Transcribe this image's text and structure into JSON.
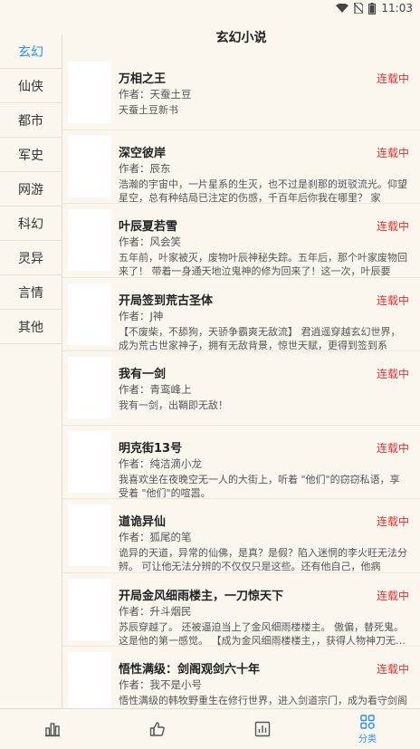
{
  "status_bar": {
    "time": "11:03"
  },
  "header": {
    "title": "玄幻小说"
  },
  "sidebar": {
    "items": [
      {
        "label": "玄幻",
        "active": true
      },
      {
        "label": "仙侠",
        "active": false
      },
      {
        "label": "都市",
        "active": false
      },
      {
        "label": "军史",
        "active": false
      },
      {
        "label": "网游",
        "active": false
      },
      {
        "label": "科幻",
        "active": false
      },
      {
        "label": "灵异",
        "active": false
      },
      {
        "label": "言情",
        "active": false
      },
      {
        "label": "其他",
        "active": false
      }
    ]
  },
  "books": [
    {
      "title": "万相之王",
      "author": "作者：天蚕土豆",
      "desc": "天蚕土豆新书",
      "status": "连载中"
    },
    {
      "title": "深空彼岸",
      "author": "作者：辰东",
      "desc": "浩瀚的宇宙中，一片星系的生灭，也不过是刹那的斑驳流光。仰望星空，总有种结局已注定的伤感，千百年后你我在哪里？ 家国，…",
      "status": "连载中"
    },
    {
      "title": "叶辰夏若雪",
      "author": "作者：风会笑",
      "desc": "五年前，叶家被灭，废物叶辰神秘失踪。五年后，那个叶家废物回来了！ 带着一身通天地泣鬼神的修为回来了！这一次，叶辰要让…",
      "status": "连载中"
    },
    {
      "title": "开局签到荒古圣体",
      "author": "作者：J神",
      "desc": "【不废柴，不舔狗，天骄争霸爽无敌流】 君逍遥穿越玄幻世界，成为荒古世家神子，拥有无敌背景，惊世天赋，更得到签到系统，…",
      "status": "连载中"
    },
    {
      "title": "我有一剑",
      "author": "作者：青鸾峰上",
      "desc": "我有一剑，出鞘即无敌！",
      "status": "连载中"
    },
    {
      "title": "明克街13号",
      "author": "作者：纯洁滴小龙",
      "desc": "我喜欢坐在夜晚空无一人的大街上，听着 \"他们\"的窃窃私语，享受着 \"他们\"的喧嚣。",
      "status": "连载中"
    },
    {
      "title": "道诡异仙",
      "author": "作者：狐尾的笔",
      "desc": "诡异的天道，异常的仙佛，是真？是假？陷入迷惘的李火旺无法分辨。 可让他无法分辨的不仅仅只是这些。还有他自己，他病了，…",
      "status": "连载中"
    },
    {
      "title": "开局金风细雨楼主，一刀惊天下",
      "author": "作者：升斗烟民",
      "desc": "苏辰穿越了。 还被逼迫当上了金风细雨楼楼主。 傲偏，替死鬼。这是他的第一感觉。 【成为金风细雨楼楼主，，获得人物神刀无…",
      "status": "连载中"
    },
    {
      "title": "悟性满级：剑阁观剑六十年",
      "author": "作者：我不是小号",
      "desc": "悟性满级的韩牧野重生在修行世界，进入剑道宗门，成为看守剑阁的观剑人。 剑阁中藏剑十万，观剑人需要每月擦拭长剑一遍。 擦…",
      "status": "连载中"
    }
  ],
  "tabbar": {
    "items": [
      {
        "icon": "bar-chart-icon",
        "label": "",
        "active": false
      },
      {
        "icon": "thumbs-up-icon",
        "label": "",
        "active": false
      },
      {
        "icon": "stats-box-icon",
        "label": "",
        "active": false
      },
      {
        "icon": "category-grid-icon",
        "label": "分类",
        "active": true
      }
    ]
  },
  "colors": {
    "accent": "#2d8ff0",
    "status_red": "#dd3333",
    "background": "#fbf7ef"
  }
}
